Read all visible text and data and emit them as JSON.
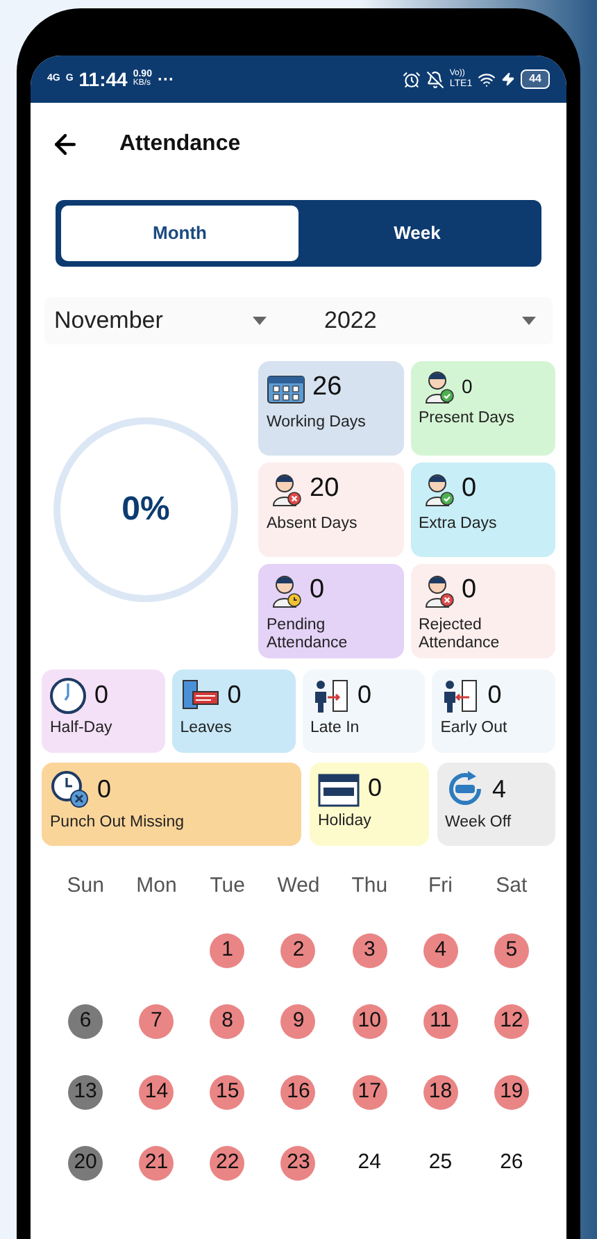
{
  "status_bar": {
    "network_1": "4G",
    "network_2": "G",
    "time": "11:44",
    "speed_value": "0.90",
    "speed_unit": "KB/s",
    "more": "···",
    "volte": "Vo))",
    "lte": "LTE1",
    "battery": "44"
  },
  "header": {
    "title": "Attendance"
  },
  "tabs": [
    {
      "label": "Month",
      "selected": true
    },
    {
      "label": "Week",
      "selected": false
    }
  ],
  "filters": [
    {
      "value": "November"
    },
    {
      "value": "2022"
    }
  ],
  "progress": {
    "reading": "0%"
  },
  "summary_cards": [
    {
      "value": "26",
      "label": "Working Days",
      "color": "#d6e2f0"
    },
    {
      "value": "0",
      "label": "Present Days",
      "color": "#d4f5d4"
    },
    {
      "value": "20",
      "label": "Absent Days",
      "color": "#fdeeee"
    },
    {
      "value": "0",
      "label": "Extra Days",
      "color": "#c8eef7"
    },
    {
      "value": "0",
      "label": "Pending Attendance",
      "color": "#e4d3f7"
    },
    {
      "value": "0",
      "label": "Rejected Attendance",
      "color": "#fdeeee"
    }
  ],
  "detail_cards": [
    {
      "value": "0",
      "label": "Half-Day",
      "color": "#f5e1f7"
    },
    {
      "value": "0",
      "label": "Leaves",
      "color": "#c8e8f8"
    },
    {
      "value": "0",
      "label": "Late In",
      "color": "#f2f7fb"
    },
    {
      "value": "0",
      "label": "Early Out",
      "color": "#f2f7fb"
    },
    {
      "value": "0",
      "label": "Punch Out Missing",
      "color": "#fad59a"
    },
    {
      "value": "0",
      "label": "Holiday",
      "color": "#fdfbcc"
    },
    {
      "value": "4",
      "label": "Week Off",
      "color": "#ececec"
    }
  ],
  "calendar": {
    "weekdays": [
      "Sun",
      "Mon",
      "Tue",
      "Wed",
      "Thu",
      "Fri",
      "Sat"
    ],
    "days": [
      {
        "day": "1",
        "color": "#ea8585"
      },
      {
        "day": "2",
        "color": "#ea8585"
      },
      {
        "day": "3",
        "color": "#ea8585"
      },
      {
        "day": "4",
        "color": "#ea8585"
      },
      {
        "day": "5",
        "color": "#ea8585"
      },
      {
        "day": "6",
        "color": "#7a7a7a"
      },
      {
        "day": "7",
        "color": "#ea8585"
      },
      {
        "day": "8",
        "color": "#ea8585"
      },
      {
        "day": "9",
        "color": "#ea8585"
      },
      {
        "day": "10",
        "color": "#ea8585"
      },
      {
        "day": "11",
        "color": "#ea8585"
      },
      {
        "day": "12",
        "color": "#ea8585"
      },
      {
        "day": "13",
        "color": "#7a7a7a"
      },
      {
        "day": "14",
        "color": "#ea8585"
      },
      {
        "day": "15",
        "color": "#ea8585"
      },
      {
        "day": "16",
        "color": "#ea8585"
      },
      {
        "day": "17",
        "color": "#ea8585"
      },
      {
        "day": "18",
        "color": "#ea8585"
      },
      {
        "day": "19",
        "color": "#ea8585"
      },
      {
        "day": "20",
        "color": "#7a7a7a"
      },
      {
        "day": "21",
        "color": "#ea8585"
      },
      {
        "day": "22",
        "color": "#ea8585"
      },
      {
        "day": "23",
        "color": "#ea8585"
      },
      {
        "day": "24"
      },
      {
        "day": "25"
      },
      {
        "day": "26"
      }
    ]
  }
}
